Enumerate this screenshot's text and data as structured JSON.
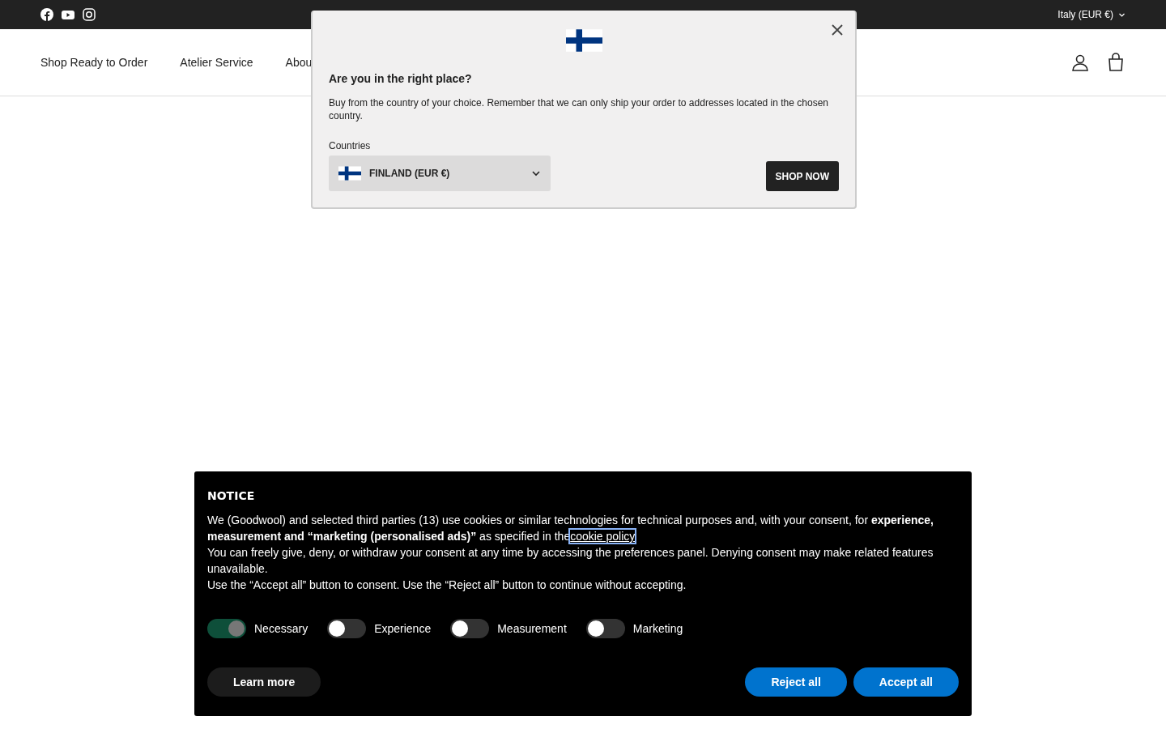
{
  "top_bar": {
    "locale": "Italy (EUR €)"
  },
  "nav": {
    "items": [
      {
        "label": "Shop Ready to Order"
      },
      {
        "label": "Atelier Service"
      },
      {
        "label": "Abou"
      }
    ]
  },
  "country_modal": {
    "title": "Are you in the right place?",
    "text": "Buy from the country of your choice. Remember that we can only ship your order to addresses located in the chosen country.",
    "select_label": "Countries",
    "select_value": "FINLAND (EUR €)",
    "button": "SHOP NOW"
  },
  "cookie_banner": {
    "title": "NOTICE",
    "paragraphs": [
      "We (Goodwool) and selected third parties (13) use cookies or similar technologies for technical purposes and, with your consent, for **experience, measurement and “marketing (personalised ads)”** as specified in the",
      "You can freely give, deny, or withdraw your consent at any time by accessing the preferences panel. Denying consent may make related features unavailable.",
      "Use the “Accept all” button to consent. Use the “Reject all” button to continue without accepting."
    ],
    "link": "cookie policy",
    "toggles": [
      {
        "label": "Necessary",
        "on": true,
        "disabled": true
      },
      {
        "label": "Experience",
        "on": false,
        "disabled": false
      },
      {
        "label": "Measurement",
        "on": false,
        "disabled": false
      },
      {
        "label": "Marketing",
        "on": false,
        "disabled": false
      }
    ],
    "buttons": [
      {
        "label": "Learn more",
        "kind": "secondary"
      },
      {
        "label": "Reject all",
        "kind": "primary"
      },
      {
        "label": "Accept all",
        "kind": "primary"
      }
    ]
  }
}
